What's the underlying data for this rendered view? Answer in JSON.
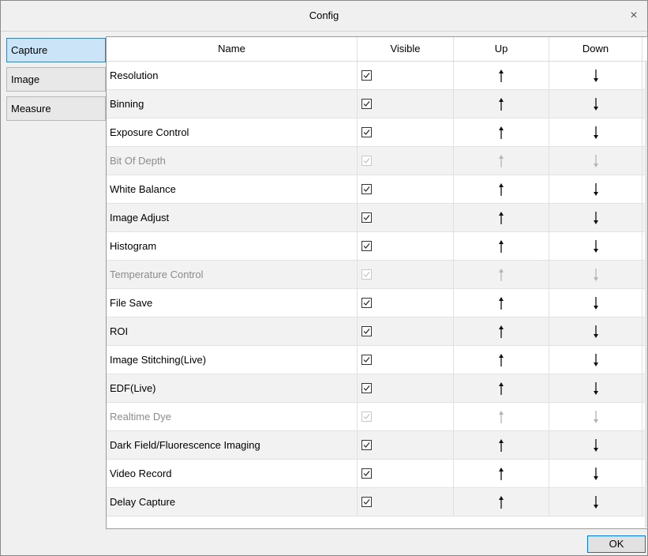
{
  "window": {
    "title": "Config",
    "close_glyph": "×"
  },
  "sidebar": {
    "tabs": [
      {
        "label": "Capture",
        "active": true
      },
      {
        "label": "Image",
        "active": false
      },
      {
        "label": "Measure",
        "active": false
      }
    ]
  },
  "table": {
    "columns": [
      "Name",
      "Visible",
      "Up",
      "Down"
    ],
    "rows": [
      {
        "name": "Resolution",
        "visible": true,
        "enabled": true
      },
      {
        "name": "Binning",
        "visible": true,
        "enabled": true
      },
      {
        "name": "Exposure Control",
        "visible": true,
        "enabled": true
      },
      {
        "name": "Bit Of Depth",
        "visible": true,
        "enabled": false
      },
      {
        "name": "White Balance",
        "visible": true,
        "enabled": true
      },
      {
        "name": "Image Adjust",
        "visible": true,
        "enabled": true
      },
      {
        "name": "Histogram",
        "visible": true,
        "enabled": true
      },
      {
        "name": "Temperature Control",
        "visible": true,
        "enabled": false
      },
      {
        "name": "File Save",
        "visible": true,
        "enabled": true
      },
      {
        "name": "ROI",
        "visible": true,
        "enabled": true
      },
      {
        "name": "Image Stitching(Live)",
        "visible": true,
        "enabled": true
      },
      {
        "name": "EDF(Live)",
        "visible": true,
        "enabled": true
      },
      {
        "name": "Realtime Dye",
        "visible": true,
        "enabled": false
      },
      {
        "name": "Dark Field/Fluorescence Imaging",
        "visible": true,
        "enabled": true
      },
      {
        "name": "Video Record",
        "visible": true,
        "enabled": true
      },
      {
        "name": "Delay Capture",
        "visible": true,
        "enabled": true
      }
    ]
  },
  "footer": {
    "ok_label": "OK"
  },
  "icons": {
    "close": "close-icon",
    "checkbox": "checkmark-icon",
    "up": "arrow-up-icon",
    "down": "arrow-down-icon"
  },
  "colors": {
    "active_tab": "#cce4f7",
    "active_tab_border": "#3c7fb1",
    "disabled_text": "#8c8c8c",
    "ok_border": "#0078d7"
  }
}
